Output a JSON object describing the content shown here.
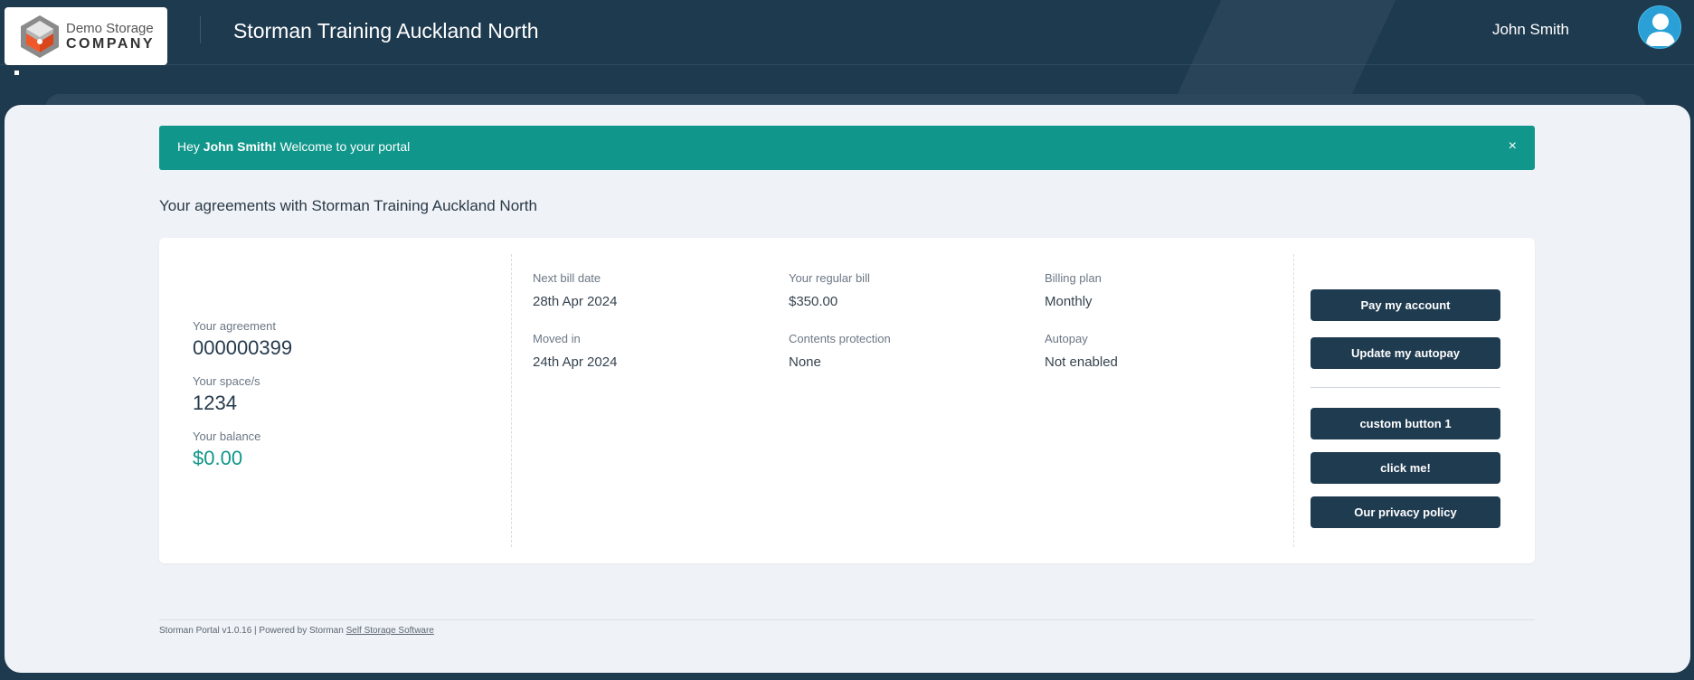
{
  "header": {
    "logo": {
      "line1": "Demo Storage",
      "line2": "COMPANY",
      "icon": "cube-logo-icon",
      "colors": {
        "gray": "#7a7a7a",
        "orange": "#f0582a"
      }
    },
    "site_title": "Storman Training Auckland North",
    "user_name": "John Smith",
    "avatar_icon": "user-avatar-icon",
    "avatar_color": "#2aa0d6"
  },
  "alert": {
    "prefix": "Hey ",
    "name": "John Smith!",
    "suffix": " Welcome to your portal",
    "close_label": "×",
    "color": "#10968a"
  },
  "agreements_heading": "Your agreements with Storman Training Auckland North",
  "agreement": {
    "agreement_label": "Your agreement",
    "agreement_value": "000000399",
    "space_label": "Your space/s",
    "space_value": "1234",
    "balance_label": "Your balance",
    "balance_value": "$0.00",
    "details": [
      {
        "label": "Next bill date",
        "value": "28th Apr 2024"
      },
      {
        "label": "Your regular bill",
        "value": "$350.00"
      },
      {
        "label": "Billing plan",
        "value": "Monthly"
      },
      {
        "label": "Moved in",
        "value": "24th Apr 2024"
      },
      {
        "label": "Contents protection",
        "value": "None"
      },
      {
        "label": "Autopay",
        "value": "Not enabled"
      }
    ],
    "buttons": {
      "pay": "Pay my account",
      "autopay": "Update my autopay",
      "custom1": "custom button 1",
      "click_me": "click me!",
      "privacy": "Our privacy policy"
    }
  },
  "footer": {
    "text": "Storman Portal v1.0.16 | Powered by Storman ",
    "link": "Self Storage Software"
  },
  "theme": {
    "navy": "#1e3a4f",
    "button": "#1f3b50",
    "teal": "#10968a",
    "content_bg": "#eff2f7"
  }
}
